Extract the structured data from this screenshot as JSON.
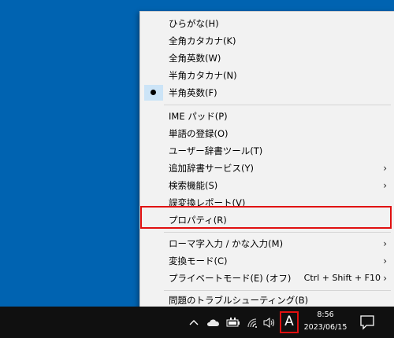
{
  "menu": {
    "items": [
      {
        "label": "ひらがな(H)"
      },
      {
        "label": "全角カタカナ(K)"
      },
      {
        "label": "全角英数(W)"
      },
      {
        "label": "半角カタカナ(N)"
      },
      {
        "label": "半角英数(F)",
        "checked": true
      },
      {
        "label": "IME パッド(P)"
      },
      {
        "label": "単語の登録(O)"
      },
      {
        "label": "ユーザー辞書ツール(T)"
      },
      {
        "label": "追加辞書サービス(Y)",
        "submenu": true
      },
      {
        "label": "検索機能(S)",
        "submenu": true
      },
      {
        "label": "誤変換レポート(V)"
      },
      {
        "label": "プロパティ(R)",
        "highlighted": true
      },
      {
        "label": "ローマ字入力 / かな入力(M)",
        "submenu": true
      },
      {
        "label": "変換モード(C)",
        "submenu": true
      },
      {
        "label": "プライベートモード(E) (オフ)",
        "shortcut": "Ctrl + Shift + F10",
        "submenu": true
      },
      {
        "label": "問題のトラブルシューティング(B)"
      }
    ]
  },
  "taskbar": {
    "ime_indicator": "A",
    "time": "8:56",
    "date": "2023/06/15",
    "icons": [
      "chevron-up-icon",
      "cloud-icon",
      "battery-icon",
      "wifi-icon",
      "speaker-icon",
      "notification-icon"
    ]
  },
  "colors": {
    "desktop": "#0063b1",
    "menu_bg": "#f2f2f2",
    "highlight_border": "#e01010",
    "taskbar": "#101010"
  }
}
